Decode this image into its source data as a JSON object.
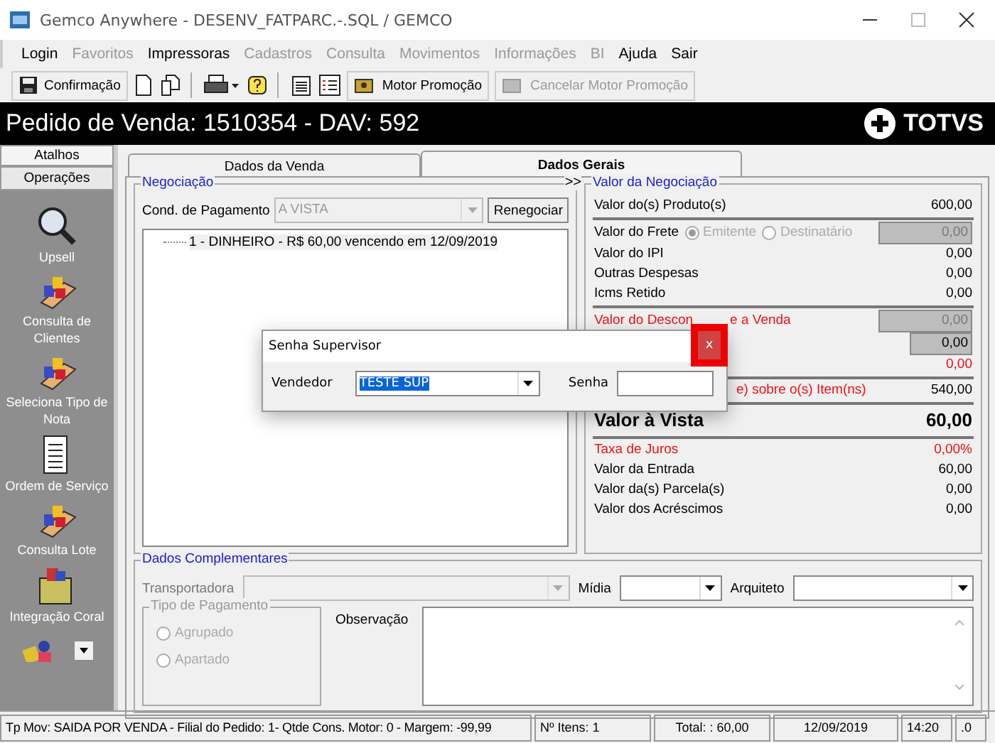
{
  "window": {
    "title": "Gemco Anywhere - DESENV_FATPARC.-.SQL / GEMCO"
  },
  "menu": [
    {
      "label": "Login",
      "disabled": false
    },
    {
      "label": "Favoritos",
      "disabled": true
    },
    {
      "label": "Impressoras",
      "disabled": false
    },
    {
      "label": "Cadastros",
      "disabled": true
    },
    {
      "label": "Consulta",
      "disabled": true
    },
    {
      "label": "Movimentos",
      "disabled": true
    },
    {
      "label": "Informações",
      "disabled": true
    },
    {
      "label": "BI",
      "disabled": true
    },
    {
      "label": "Ajuda",
      "disabled": false
    },
    {
      "label": "Sair",
      "disabled": false
    }
  ],
  "toolbar": {
    "confirm": "Confirmação",
    "motor": "Motor Promoção",
    "cancel_motor": {
      "label": "Cancelar Motor Promoção",
      "disabled": true
    }
  },
  "header": {
    "title": "Pedido de Venda: 1510354  - DAV: 592",
    "logo": "TOTVS"
  },
  "sidebar": {
    "tabs": [
      {
        "label": "Atalhos",
        "selected": false
      },
      {
        "label": "Operações",
        "selected": true
      }
    ],
    "items": [
      {
        "label": "Upsell",
        "kind": "search"
      },
      {
        "label": "Consulta de Clientes",
        "kind": "blocks"
      },
      {
        "label": "Seleciona Tipo de Nota",
        "kind": "blocks"
      },
      {
        "label": "Ordem de Serviço",
        "kind": "document"
      },
      {
        "label": "Consulta Lote",
        "kind": "blocks"
      },
      {
        "label": "Integração Coral",
        "kind": "box"
      }
    ]
  },
  "tabs": [
    {
      "label": "Dados da Venda",
      "selected": false
    },
    {
      "label": "Dados Gerais",
      "selected": true
    }
  ],
  "negociacao": {
    "title": "Negociação",
    "expand": ">>",
    "cond_label": "Cond. de Pagamento",
    "cond_value": "A VISTA",
    "button": "Renegociar",
    "installments": [
      "1 - DINHEIRO - R$ 60,00 vencendo em  12/09/2019"
    ]
  },
  "valores": {
    "title": "Valor da Negociação",
    "rows": [
      {
        "kind": "value",
        "label": "Valor do(s) Produto(s)",
        "value": "600,00",
        "rule": true
      },
      {
        "kind": "freight",
        "label": "Valor do Frete",
        "options": [
          {
            "label": "Emitente",
            "selected": true
          },
          {
            "label": "Destinatário",
            "selected": false
          }
        ],
        "value": "0,00"
      },
      {
        "kind": "value",
        "label": "Valor do IPI",
        "value": "0,00"
      },
      {
        "kind": "value",
        "label": "Outras Despesas",
        "value": "0,00"
      },
      {
        "kind": "value",
        "label": "Icms Retido",
        "value": "0,00",
        "rule": true
      },
      {
        "kind": "input",
        "label": "Valor do Descon",
        "label_tail": "e a Venda",
        "value": "0,00",
        "alert": true
      },
      {
        "kind": "input-short",
        "value": "0,00"
      },
      {
        "kind": "value",
        "value": "0,00",
        "alert": true,
        "rule": true
      },
      {
        "kind": "covered",
        "label": "e) sobre o(s) Item(ns)",
        "value": "540,00",
        "alert": true,
        "rule": true
      },
      {
        "kind": "total",
        "label": "Valor à Vista",
        "value": "60,00",
        "rule": true
      },
      {
        "kind": "value",
        "label": "Taxa de Juros",
        "value": "0,00%",
        "alert": true
      },
      {
        "kind": "value",
        "label": "Valor da Entrada",
        "value": "60,00"
      },
      {
        "kind": "value",
        "label": "Valor da(s) Parcela(s)",
        "value": "0,00"
      },
      {
        "kind": "value",
        "label": "Valor dos Acréscimos",
        "value": "0,00"
      }
    ]
  },
  "complementares": {
    "title": "Dados Complementares",
    "transportadora": "Transportadora",
    "midia": "Mídia",
    "arquiteto": "Arquiteto",
    "pagamento": {
      "title": "Tipo de Pagamento",
      "options": [
        {
          "label": "Agrupado",
          "selected": false
        },
        {
          "label": "Apartado",
          "selected": false
        }
      ]
    },
    "observacao": "Observação"
  },
  "dialog": {
    "title": "Senha Supervisor",
    "close": "x",
    "vendedor_label": "Vendedor",
    "vendedor": "TESTE SUP",
    "senha_label": "Senha"
  },
  "status_bar": [
    "Tp Mov: SAIDA POR VENDA - Filial do Pedido: 1-  Qtde Cons. Motor: 0  - Margem: -99,99",
    "Nº Itens: 1",
    "Total: : 60,00",
    "12/09/2019",
    "14:20",
    ".0"
  ]
}
